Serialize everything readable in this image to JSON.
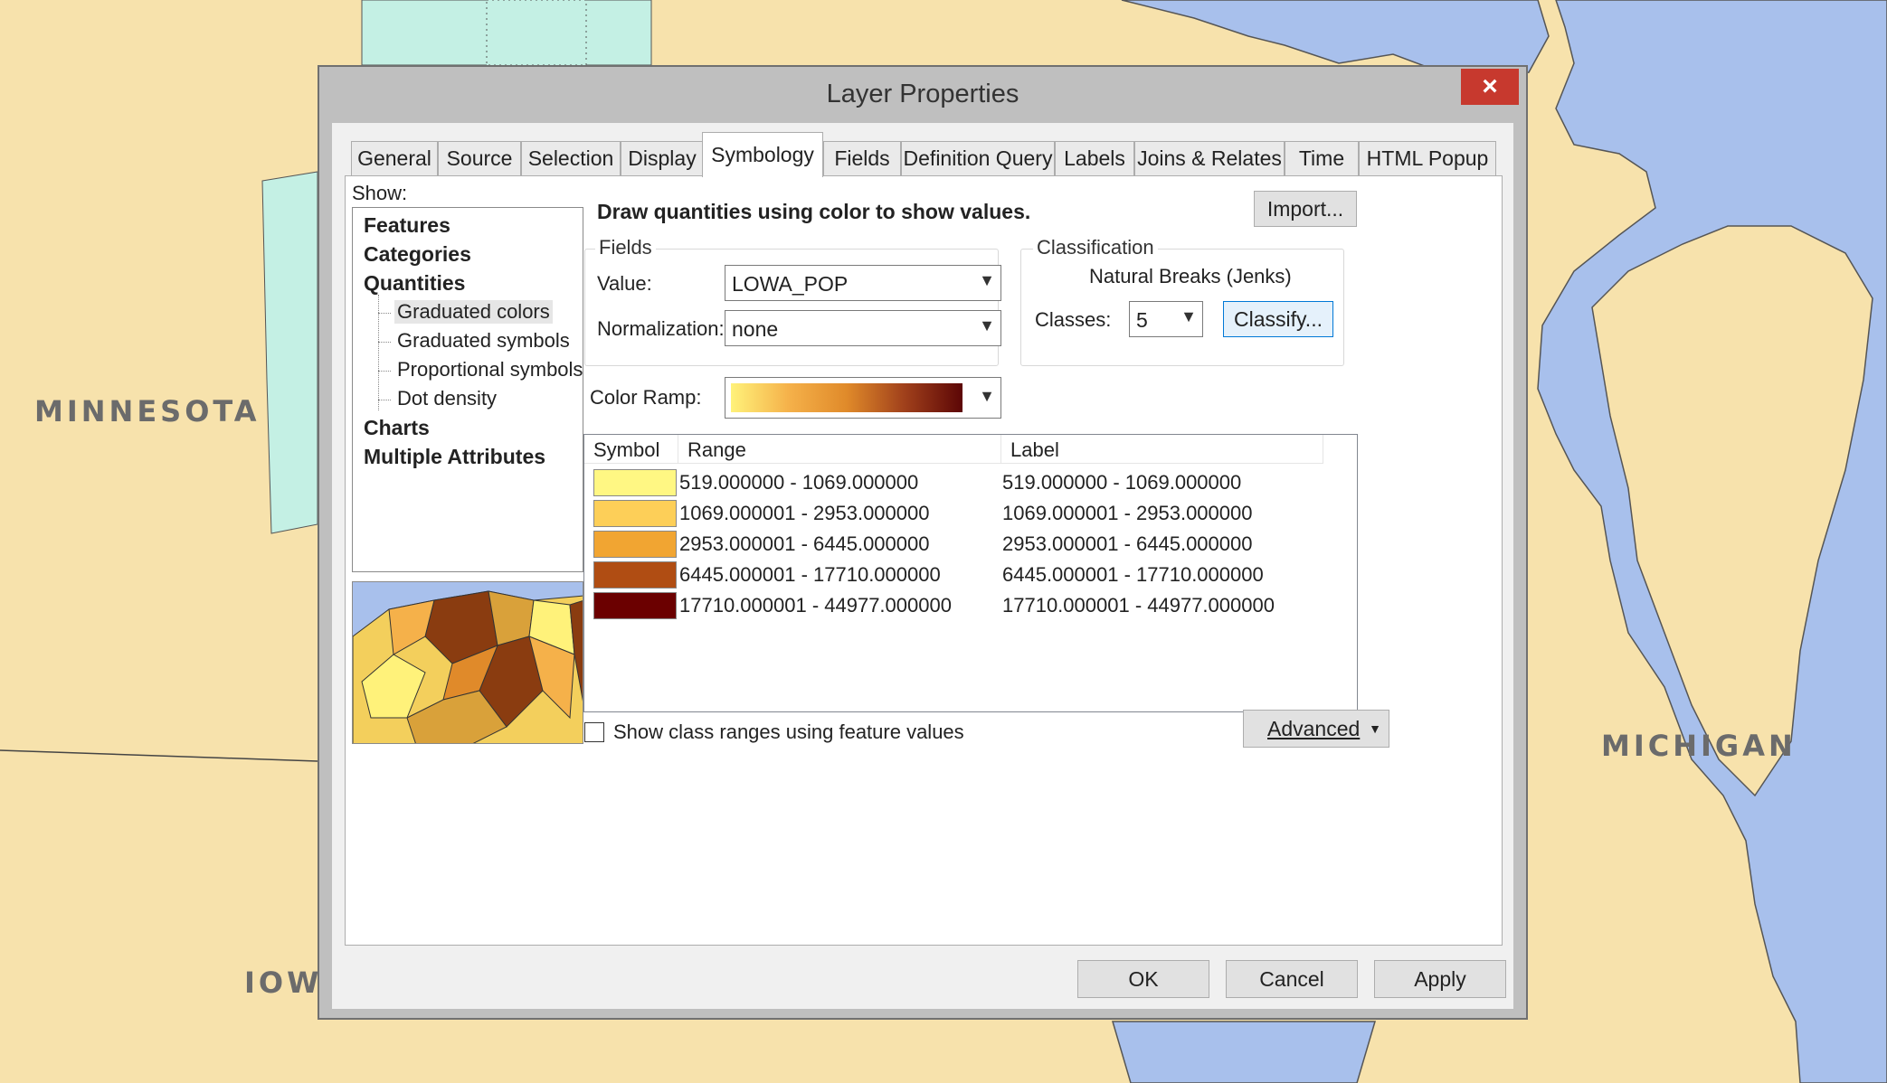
{
  "map": {
    "labels": {
      "minnesota": "MINNESOTA",
      "iowa": "IOWA",
      "michigan": "MICHIGAN"
    },
    "colors": {
      "land": "#f7e2ac",
      "water": "#a8c0ec",
      "teal": "#c4f0e4"
    }
  },
  "dialog": {
    "title": "Layer Properties",
    "close_glyph": "×",
    "close_icon": "close-icon",
    "tabs": [
      "General",
      "Source",
      "Selection",
      "Display",
      "Symbology",
      "Fields",
      "Definition Query",
      "Labels",
      "Joins & Relates",
      "Time",
      "HTML Popup"
    ],
    "active_tab": "Symbology",
    "show_label": "Show:",
    "show_tree": {
      "features": "Features",
      "categories": "Categories",
      "quantities": "Quantities",
      "quantities_children": [
        "Graduated colors",
        "Graduated symbols",
        "Proportional symbols",
        "Dot density"
      ],
      "selected": "Graduated colors",
      "charts": "Charts",
      "multiple_attributes": "Multiple Attributes"
    },
    "description": "Draw quantities using color to show values.",
    "import_label": "Import...",
    "fields": {
      "group_label": "Fields",
      "value_label": "Value:",
      "value": "LOWA_POP",
      "normalization_label": "Normalization:",
      "normalization": "none"
    },
    "classification": {
      "group_label": "Classification",
      "method": "Natural Breaks (Jenks)",
      "classes_label": "Classes:",
      "classes": "5",
      "classify_label": "Classify..."
    },
    "color_ramp_label": "Color Ramp:",
    "color_ramp": [
      "#fff27a",
      "#f5b14a",
      "#e08a2a",
      "#a0401b",
      "#5c0606"
    ],
    "grid": {
      "headers": {
        "symbol": "Symbol",
        "range": "Range",
        "label": "Label"
      },
      "rows": [
        {
          "color": "#fff783",
          "range": "519.000000 - 1069.000000",
          "label": "519.000000 - 1069.000000"
        },
        {
          "color": "#fdcf58",
          "range": "1069.000001 - 2953.000000",
          "label": "1069.000001 - 2953.000000"
        },
        {
          "color": "#f1a532",
          "range": "2953.000001 - 6445.000000",
          "label": "2953.000001 - 6445.000000"
        },
        {
          "color": "#b04d13",
          "range": "6445.000001 - 17710.000000",
          "label": "6445.000001 - 17710.000000"
        },
        {
          "color": "#6b0000",
          "range": "17710.000001 - 44977.000000",
          "label": "17710.000001 - 44977.000000"
        }
      ]
    },
    "show_ranges_label": "Show class ranges using feature values",
    "show_ranges_checked": false,
    "advanced_label": "Advanced",
    "buttons": {
      "ok": "OK",
      "cancel": "Cancel",
      "apply": "Apply"
    }
  }
}
